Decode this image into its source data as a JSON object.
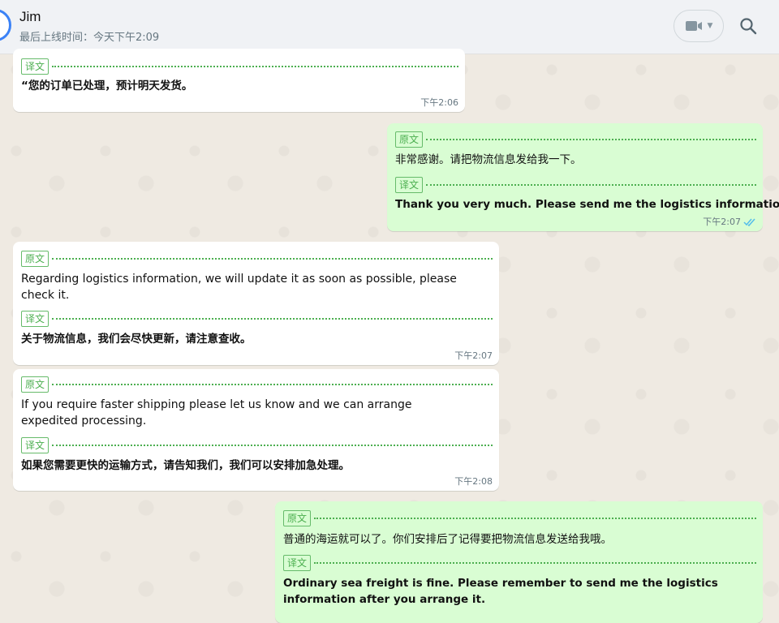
{
  "header": {
    "contact_name": "Jim",
    "last_seen": "最后上线时间：今天下午2:09"
  },
  "labels": {
    "original": "原文",
    "translation": "译文"
  },
  "messages": [
    {
      "translation_text": "“您的订单已处理，预计明天发货。",
      "time": "下午2:06"
    },
    {
      "original_text": "非常感谢。请把物流信息发给我一下。",
      "translation_text": "Thank you very much. Please send me the logistics information.",
      "time": "下午2:07"
    },
    {
      "original_text": "Regarding logistics information, we will update it as soon as possible, please check it.",
      "translation_text": "关于物流信息，我们会尽快更新，请注意查收。",
      "time": "下午2:07"
    },
    {
      "original_text": "If you require faster shipping please let us know and we can arrange expedited processing.",
      "translation_text": "如果您需要更快的运输方式，请告知我们，我们可以安排加急处理。",
      "time": "下午2:08"
    },
    {
      "original_text": "普通的海运就可以了。你们安排后了记得要把物流信息发送给我哦。",
      "translation_text": "Ordinary sea freight is fine. Please remember to send me the logistics information after you arrange it."
    }
  ],
  "colors": {
    "incoming_bubble": "#ffffff",
    "outgoing_bubble": "#d9fdd3",
    "label_green": "#4caf50",
    "read_ticks": "#53bdeb"
  },
  "icons": [
    "video-camera-icon",
    "chevron-down-icon",
    "search-icon",
    "double-check-icon"
  ]
}
